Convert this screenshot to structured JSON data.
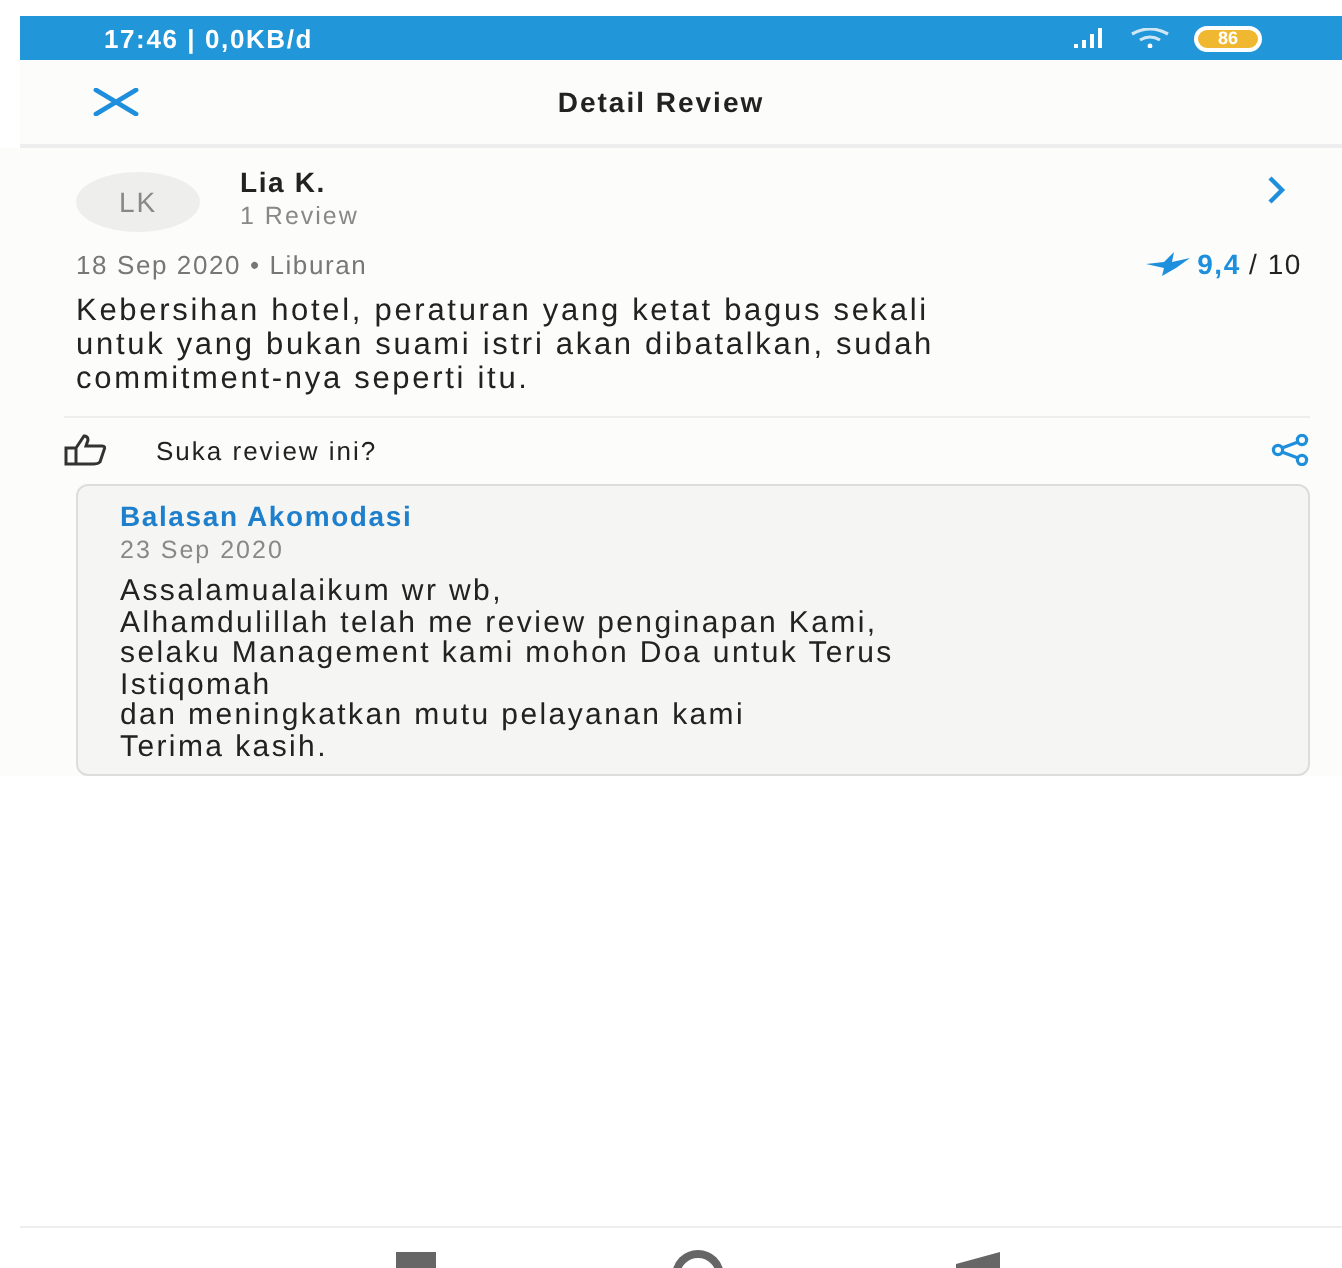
{
  "status_bar": {
    "time": "17:46 | 0,0KB/d",
    "battery": "86"
  },
  "header": {
    "title": "Detail Review"
  },
  "reviewer": {
    "initials": "LK",
    "name": "Lia K.",
    "review_count": "1 Review"
  },
  "review": {
    "date_trip": "18 Sep 2020 • Liburan",
    "score": "9,4",
    "score_max": "/ 10",
    "text_lines": [
      "Kebersihan hotel, peraturan yang ketat bagus sekali",
      "untuk yang bukan suami istri akan dibatalkan, sudah",
      "commitment-nya seperti itu."
    ]
  },
  "like": {
    "label": "Suka review ini?"
  },
  "reply": {
    "title": "Balasan Akomodasi",
    "date": "23 Sep 2020",
    "lines": [
      "Assalamualaikum wr wb,",
      "Alhamdulillah telah me review penginapan Kami,",
      "selaku Management kami mohon Doa untuk Terus",
      "Istiqomah",
      "dan meningkatkan mutu pelayanan kami",
      "Terima kasih."
    ]
  }
}
